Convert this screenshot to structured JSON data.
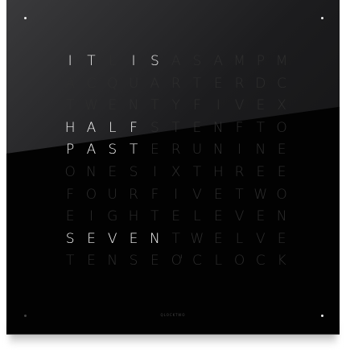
{
  "clock": {
    "rows": [
      "ITLISASAMPM",
      "ACQUARTERDC",
      "TWENTYFIVEX",
      "HALFSTENFTO",
      "PASTERUNINE",
      "ONESIXTHREE",
      "FOURFIVETWO",
      "EIGHTELEVEN",
      "SEVENTWELVE",
      "TENSEOCLOCK"
    ],
    "lit": [
      [
        0,
        0
      ],
      [
        0,
        1
      ],
      [
        0,
        3
      ],
      [
        0,
        4
      ],
      [
        3,
        0
      ],
      [
        3,
        1
      ],
      [
        3,
        2
      ],
      [
        3,
        3
      ],
      [
        4,
        0
      ],
      [
        4,
        1
      ],
      [
        4,
        2
      ],
      [
        4,
        3
      ],
      [
        8,
        0
      ],
      [
        8,
        1
      ],
      [
        8,
        2
      ],
      [
        8,
        3
      ],
      [
        8,
        4
      ]
    ],
    "displayed_time": "IT IS HALF PAST SEVEN",
    "minute_dots": {
      "top_left": true,
      "top_right": true,
      "bottom_left": false,
      "bottom_right": true
    },
    "brand": "QLOCKTWO",
    "colors": {
      "lit": "#f4f4f4",
      "unlit": "#2e2e2e",
      "face": "#020202"
    }
  }
}
